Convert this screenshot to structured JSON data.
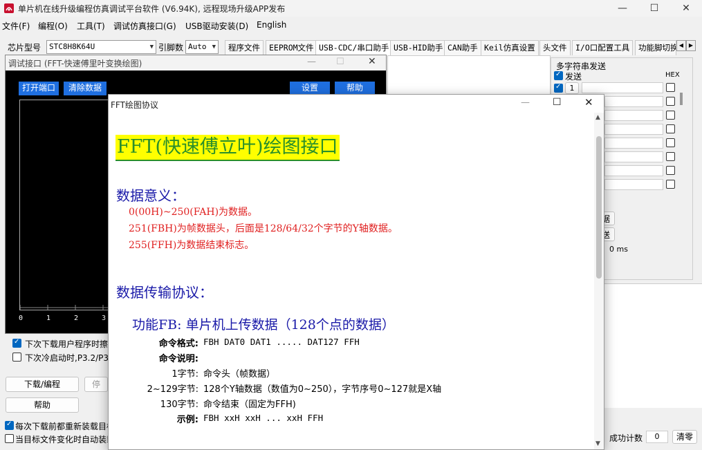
{
  "app": {
    "title": "单片机在线升级编程仿真调试平台软件 (V6.94K), 远程现场升级APP发布",
    "window_controls": {
      "minimize": "—",
      "maximize": "☐",
      "close": "✕"
    }
  },
  "menu": [
    "文件(F)",
    "编程(O)",
    "工具(T)",
    "调试仿真接口(G)",
    "USB驱动安装(D)",
    "English"
  ],
  "toolbar": {
    "chip_label": "芯片型号",
    "chip_value": "STC8H8K64U",
    "pins_label": "引脚数",
    "pins_value": "Auto"
  },
  "tabs": [
    "程序文件",
    "EEPROM文件",
    "USB-CDC/串口助手",
    "USB-HID助手",
    "CAN助手",
    "Keil仿真设置",
    "头文件",
    "I/O口配置工具",
    "功能脚切换"
  ],
  "tab_scroll": {
    "left": "◀",
    "right": "▶"
  },
  "right_panel": {
    "title": "多字符串发送",
    "send_label": "发送",
    "hex_label": "HEX",
    "row1_num": "1",
    "frag1": "据",
    "frag2": "送",
    "frag3": "0 ms"
  },
  "left_options": {
    "opt1": "下次下载用户程序时擦",
    "opt2": "下次冷启动时,P3.2/P3",
    "download_button": "下载/编程",
    "stop_button": "停",
    "help_button": "帮助",
    "opt3": "每次下载前都重新装载目标",
    "opt4": "当目标文件变化时自动装载"
  },
  "status_bar": {
    "success_label": "成功计数",
    "success_value": "0",
    "clear_button": "清零"
  },
  "debug_window": {
    "title": "调试接口 (FFT-快速傅里叶变换绘图)",
    "open_port": "打开端口",
    "clear_data": "清除数据",
    "settings": "设置",
    "help": "帮助",
    "x_ticks": [
      "0",
      "1",
      "2",
      "3"
    ]
  },
  "fft_dialog": {
    "title": "FFT绘图协议",
    "heading": "FFT(快速傅立叶)绘图接口",
    "section1": "数据意义：",
    "line1": "0(00H)~250(FAH)为数据。",
    "line2": "251(FBH)为帧数据头，后面是128/64/32个字节的Y轴数据。",
    "line3": "255(FFH)为数据结束标志。",
    "section2": "数据传输协议：",
    "func_title": "功能FB:  单片机上传数据（128个点的数据）",
    "cmd_format_label": "命令格式:",
    "cmd_format_value": "FBH DAT0 DAT1 ..... DAT127 FFH",
    "cmd_desc_label": "命令说明:",
    "byte1_label": "1字节:",
    "byte1_value": "命令头（帧数据）",
    "byte2_label": "2~129字节:",
    "byte2_value": "128个Y轴数据（数值为0~250），字节序号0~127就是X轴",
    "byte3_label": "130字节:",
    "byte3_value": "命令结束（固定为FFH)",
    "example_label": "示例:",
    "example_value": "FBH xxH xxH ... xxH FFH"
  }
}
